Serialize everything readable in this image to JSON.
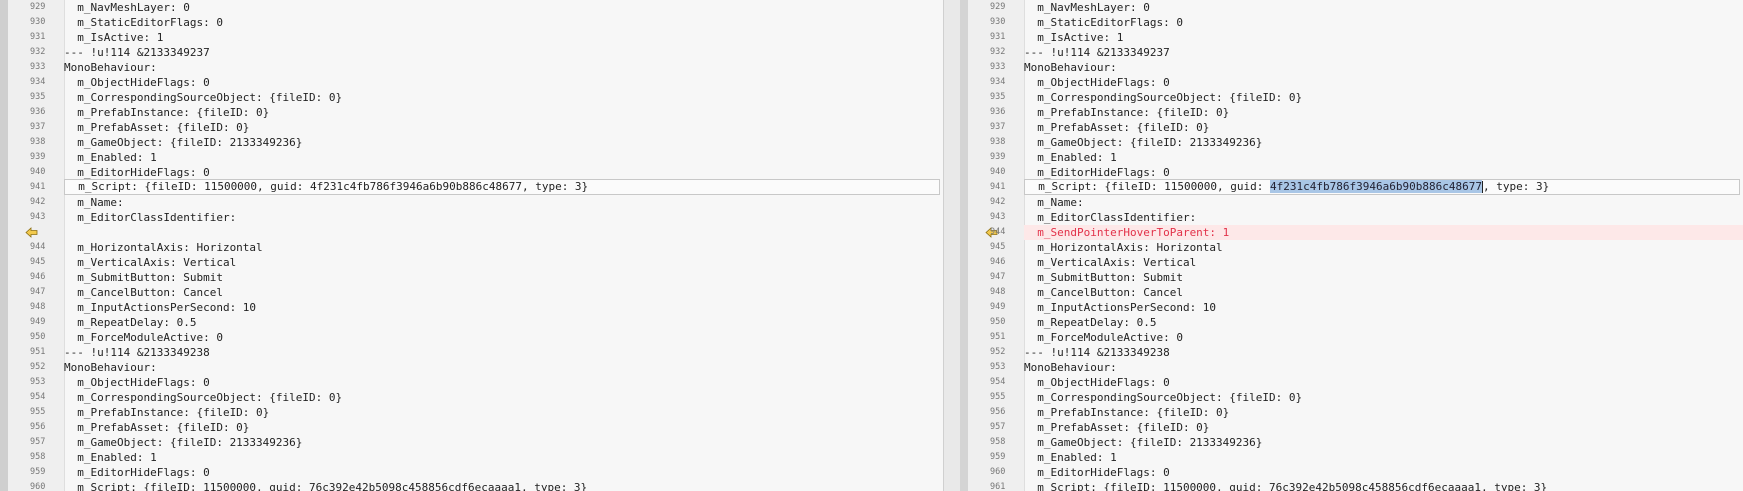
{
  "colors": {
    "added_background": "#fde8e8",
    "added_text": "#e2324a",
    "selection": "#a9c6e6",
    "change_arrow": "#f2c94c"
  },
  "left": {
    "lines": [
      {
        "n": "929",
        "t": "  m_NavMeshLayer: 0"
      },
      {
        "n": "930",
        "t": "  m_StaticEditorFlags: 0"
      },
      {
        "n": "931",
        "t": "  m_IsActive: 1"
      },
      {
        "n": "932",
        "t": "--- !u!114 &2133349237"
      },
      {
        "n": "933",
        "t": "MonoBehaviour:"
      },
      {
        "n": "934",
        "t": "  m_ObjectHideFlags: 0"
      },
      {
        "n": "935",
        "t": "  m_CorrespondingSourceObject: {fileID: 0}"
      },
      {
        "n": "936",
        "t": "  m_PrefabInstance: {fileID: 0}"
      },
      {
        "n": "937",
        "t": "  m_PrefabAsset: {fileID: 0}"
      },
      {
        "n": "938",
        "t": "  m_GameObject: {fileID: 2133349236}"
      },
      {
        "n": "939",
        "t": "  m_Enabled: 1"
      },
      {
        "n": "940",
        "t": "  m_EditorHideFlags: 0"
      },
      {
        "n": "941",
        "t": "  m_Script: {fileID: 11500000, guid: 4f231c4fb786f3946a6b90b886c48677, type: 3}",
        "boxed": true
      },
      {
        "n": "942",
        "t": "  m_Name:"
      },
      {
        "n": "943",
        "t": "  m_EditorClassIdentifier:"
      },
      {
        "n": "",
        "t": "",
        "hatched": true,
        "arrow": true
      },
      {
        "n": "944",
        "t": "  m_HorizontalAxis: Horizontal"
      },
      {
        "n": "945",
        "t": "  m_VerticalAxis: Vertical"
      },
      {
        "n": "946",
        "t": "  m_SubmitButton: Submit"
      },
      {
        "n": "947",
        "t": "  m_CancelButton: Cancel"
      },
      {
        "n": "948",
        "t": "  m_InputActionsPerSecond: 10"
      },
      {
        "n": "949",
        "t": "  m_RepeatDelay: 0.5"
      },
      {
        "n": "950",
        "t": "  m_ForceModuleActive: 0"
      },
      {
        "n": "951",
        "t": "--- !u!114 &2133349238"
      },
      {
        "n": "952",
        "t": "MonoBehaviour:"
      },
      {
        "n": "953",
        "t": "  m_ObjectHideFlags: 0"
      },
      {
        "n": "954",
        "t": "  m_CorrespondingSourceObject: {fileID: 0}"
      },
      {
        "n": "955",
        "t": "  m_PrefabInstance: {fileID: 0}"
      },
      {
        "n": "956",
        "t": "  m_PrefabAsset: {fileID: 0}"
      },
      {
        "n": "957",
        "t": "  m_GameObject: {fileID: 2133349236}"
      },
      {
        "n": "958",
        "t": "  m_Enabled: 1"
      },
      {
        "n": "959",
        "t": "  m_EditorHideFlags: 0"
      },
      {
        "n": "960",
        "t": "  m_Script: {fileID: 11500000, guid: 76c392e42b5098c458856cdf6ecaaaa1, type: 3}"
      }
    ]
  },
  "right": {
    "lines": [
      {
        "n": "929",
        "t": "  m_NavMeshLayer: 0"
      },
      {
        "n": "930",
        "t": "  m_StaticEditorFlags: 0"
      },
      {
        "n": "931",
        "t": "  m_IsActive: 1"
      },
      {
        "n": "932",
        "t": "--- !u!114 &2133349237"
      },
      {
        "n": "933",
        "t": "MonoBehaviour:"
      },
      {
        "n": "934",
        "t": "  m_ObjectHideFlags: 0"
      },
      {
        "n": "935",
        "t": "  m_CorrespondingSourceObject: {fileID: 0}"
      },
      {
        "n": "936",
        "t": "  m_PrefabInstance: {fileID: 0}"
      },
      {
        "n": "937",
        "t": "  m_PrefabAsset: {fileID: 0}"
      },
      {
        "n": "938",
        "t": "  m_GameObject: {fileID: 2133349236}"
      },
      {
        "n": "939",
        "t": "  m_Enabled: 1"
      },
      {
        "n": "940",
        "t": "  m_EditorHideFlags: 0"
      },
      {
        "n": "941",
        "t": "  m_Script: {fileID: 11500000, guid: ",
        "sel": "4f231c4fb786f3946a6b90b886c48677",
        "after": ", type: 3}",
        "boxed": true
      },
      {
        "n": "942",
        "t": "  m_Name:"
      },
      {
        "n": "943",
        "t": "  m_EditorClassIdentifier:"
      },
      {
        "n": "944",
        "t": "  m_SendPointerHoverToParent: 1",
        "added": true,
        "arrow": true
      },
      {
        "n": "945",
        "t": "  m_HorizontalAxis: Horizontal"
      },
      {
        "n": "946",
        "t": "  m_VerticalAxis: Vertical"
      },
      {
        "n": "947",
        "t": "  m_SubmitButton: Submit"
      },
      {
        "n": "948",
        "t": "  m_CancelButton: Cancel"
      },
      {
        "n": "949",
        "t": "  m_InputActionsPerSecond: 10"
      },
      {
        "n": "950",
        "t": "  m_RepeatDelay: 0.5"
      },
      {
        "n": "951",
        "t": "  m_ForceModuleActive: 0"
      },
      {
        "n": "952",
        "t": "--- !u!114 &2133349238"
      },
      {
        "n": "953",
        "t": "MonoBehaviour:"
      },
      {
        "n": "954",
        "t": "  m_ObjectHideFlags: 0"
      },
      {
        "n": "955",
        "t": "  m_CorrespondingSourceObject: {fileID: 0}"
      },
      {
        "n": "956",
        "t": "  m_PrefabInstance: {fileID: 0}"
      },
      {
        "n": "957",
        "t": "  m_PrefabAsset: {fileID: 0}"
      },
      {
        "n": "958",
        "t": "  m_GameObject: {fileID: 2133349236}"
      },
      {
        "n": "959",
        "t": "  m_Enabled: 1"
      },
      {
        "n": "960",
        "t": "  m_EditorHideFlags: 0"
      },
      {
        "n": "961",
        "t": "  m_Script: {fileID: 11500000, guid: 76c392e42b5098c458856cdf6ecaaaa1, type: 3}"
      }
    ]
  }
}
